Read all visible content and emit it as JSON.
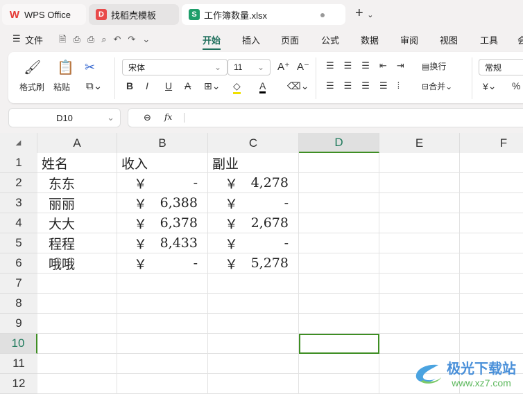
{
  "tabs": [
    {
      "label": "WPS Office",
      "icon": "wps-logo-icon"
    },
    {
      "label": "找稻壳模板",
      "icon": "docer-icon"
    },
    {
      "label": "工作簿数量.xlsx",
      "icon": "spreadsheet-icon"
    }
  ],
  "menu": {
    "file": "文件",
    "items": [
      "开始",
      "插入",
      "页面",
      "公式",
      "数据",
      "审阅",
      "视图",
      "工具",
      "会"
    ],
    "active": "开始"
  },
  "ribbon": {
    "format_painter": "格式刷",
    "paste": "粘贴",
    "font": "宋体",
    "size": "11",
    "wrap": "换行",
    "merge": "合并",
    "number_format": "常规",
    "currency": "¥",
    "percent": "%",
    "bold": "B",
    "italic": "I",
    "underline": "U",
    "strike": "A",
    "font_color": "A"
  },
  "namebox": "D10",
  "fx": "fx",
  "columns": [
    "A",
    "B",
    "C",
    "D",
    "E",
    "F"
  ],
  "active_col": "D",
  "active_row": 10,
  "rows": [
    {
      "n": "1",
      "cells": [
        "姓名",
        "收入",
        "副业"
      ]
    },
    {
      "n": "2",
      "cells": [
        "东东",
        {
          "sym": "￥",
          "val": "-"
        },
        {
          "sym": "￥",
          "val": "4,278"
        }
      ]
    },
    {
      "n": "3",
      "cells": [
        "丽丽",
        {
          "sym": "￥",
          "val": "6,388"
        },
        {
          "sym": "￥",
          "val": "-"
        }
      ]
    },
    {
      "n": "4",
      "cells": [
        "大大",
        {
          "sym": "￥",
          "val": "6,378"
        },
        {
          "sym": "￥",
          "val": "2,678"
        }
      ]
    },
    {
      "n": "5",
      "cells": [
        "程程",
        {
          "sym": "￥",
          "val": "8,433"
        },
        {
          "sym": "￥",
          "val": "-"
        }
      ]
    },
    {
      "n": "6",
      "cells": [
        "哦哦",
        {
          "sym": "￥",
          "val": "-"
        },
        {
          "sym": "￥",
          "val": "5,278"
        }
      ]
    },
    {
      "n": "7",
      "cells": []
    },
    {
      "n": "8",
      "cells": []
    },
    {
      "n": "9",
      "cells": []
    },
    {
      "n": "10",
      "cells": []
    },
    {
      "n": "11",
      "cells": []
    },
    {
      "n": "12",
      "cells": []
    }
  ],
  "watermark": {
    "name": "极光下载站",
    "url": "www.xz7.com"
  }
}
